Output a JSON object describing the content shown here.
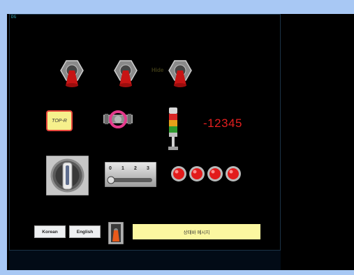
{
  "corner_tag": "DG",
  "toggles": [
    "toggle-1",
    "toggle-2",
    "toggle-3"
  ],
  "hide_label": "Hide",
  "topr_label": "TOP-R",
  "counter_value": "-12345",
  "selector_scale": [
    "0",
    "1",
    "2",
    "3"
  ],
  "led_count": 4,
  "buttons": {
    "korean": "Korean",
    "english": "English"
  },
  "message_text": "상태바 메시지",
  "colors": {
    "background": "#000000",
    "counter": "#e31f1f",
    "led": "#e21b1b",
    "message_bg": "#fbf7a0"
  }
}
